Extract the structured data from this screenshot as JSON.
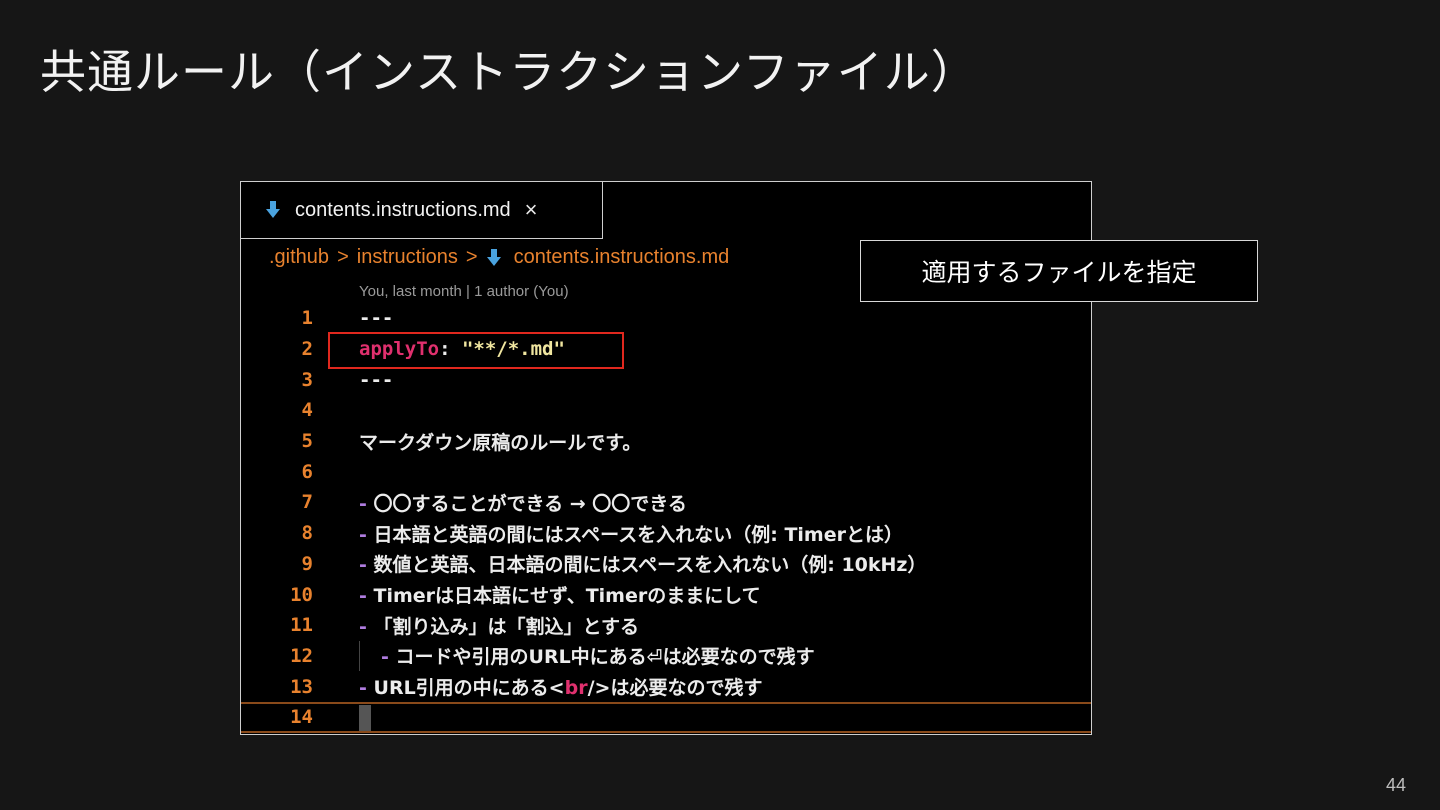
{
  "slide": {
    "title": "共通ルール（インストラクションファイル）",
    "page_number": "44"
  },
  "editor": {
    "tab": {
      "filename": "contents.instructions.md",
      "close_glyph": "×",
      "icon": "markdown-down-arrow-icon"
    },
    "breadcrumb": {
      "parts": [
        ".github",
        "instructions",
        "contents.instructions.md"
      ],
      "separator": ">"
    },
    "blame": "You, last month | 1 author (You)",
    "lines": [
      {
        "num": "1",
        "text": "---"
      },
      {
        "num": "2",
        "key": "applyTo",
        "colon": ":",
        "value": "\"**/*.md\""
      },
      {
        "num": "3",
        "text": "---"
      },
      {
        "num": "4",
        "text": ""
      },
      {
        "num": "5",
        "text": "マークダウン原稿のルールです。"
      },
      {
        "num": "6",
        "text": ""
      },
      {
        "num": "7",
        "bullet": "-",
        "text": "〇〇することができる → 〇〇できる"
      },
      {
        "num": "8",
        "bullet": "-",
        "text": "日本語と英語の間にはスペースを入れない（例: Timerとは）"
      },
      {
        "num": "9",
        "bullet": "-",
        "text": "数値と英語、日本語の間にはスペースを入れない（例: 10kHz）"
      },
      {
        "num": "10",
        "bullet": "-",
        "text": "Timerは日本語にせず、Timerのままにして"
      },
      {
        "num": "11",
        "bullet": "-",
        "text": "「割り込み」は「割込」とする"
      },
      {
        "num": "12",
        "bullet": "-",
        "text": "コードや引用のURL中にある⏎は必要なので残す"
      },
      {
        "num": "13",
        "bullet": "-",
        "text_before": "URL引用の中にある<",
        "tag": "br",
        "text_after": "/>は必要なので残す"
      },
      {
        "num": "14",
        "text": ""
      }
    ]
  },
  "callout": {
    "text": "適用するファイルを指定"
  },
  "colors": {
    "background": "#161616",
    "accent_orange": "#e8822e",
    "key_pink": "#e0306e",
    "string_yellow": "#f0e6a0",
    "highlight_red": "#e0281e"
  }
}
